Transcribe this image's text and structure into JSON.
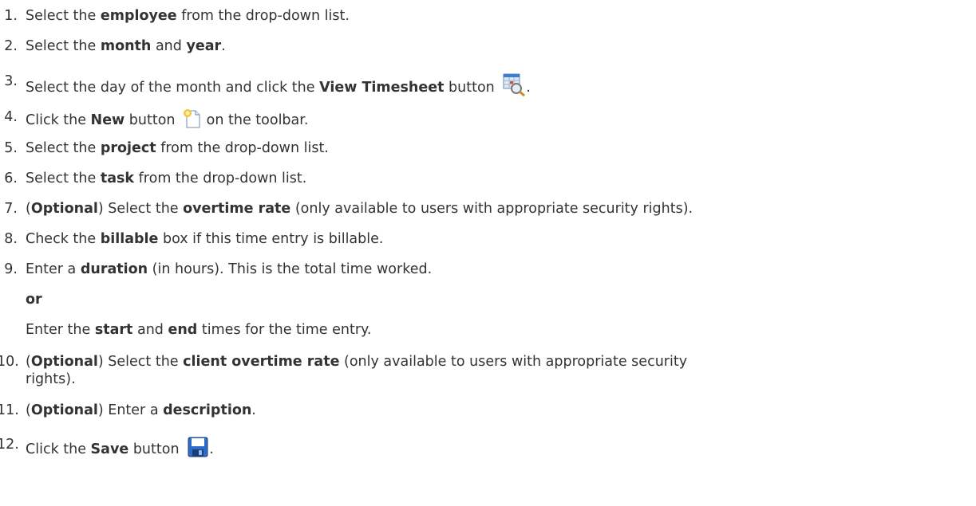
{
  "steps": [
    {
      "num": "1.",
      "parts": [
        [
          "Select the ",
          0
        ],
        [
          "employee",
          1
        ],
        [
          " from the drop-down list.",
          0
        ]
      ]
    },
    {
      "num": "2.",
      "parts": [
        [
          "Select the ",
          0
        ],
        [
          "month",
          1
        ],
        [
          " and ",
          0
        ],
        [
          "year",
          1
        ],
        [
          ".",
          0
        ]
      ]
    },
    {
      "num": "3.",
      "parts": [
        [
          "Select the day of the month and click the ",
          0
        ],
        [
          "View Timesheet",
          1
        ],
        [
          " button ",
          0
        ]
      ],
      "after": ".",
      "icon": "view-timesheet-icon"
    },
    {
      "num": "4.",
      "parts": [
        [
          "Click the ",
          0
        ],
        [
          "New",
          1
        ],
        [
          " button ",
          0
        ]
      ],
      "icon": "new-document-icon",
      "after": " on the toolbar."
    },
    {
      "num": "5.",
      "parts": [
        [
          "Select the ",
          0
        ],
        [
          "project",
          1
        ],
        [
          " from the drop-down list.",
          0
        ]
      ]
    },
    {
      "num": "6.",
      "parts": [
        [
          "Select the ",
          0
        ],
        [
          "task",
          1
        ],
        [
          " from the drop-down list.",
          0
        ]
      ]
    },
    {
      "num": "7.",
      "parts": [
        [
          "(",
          0
        ],
        [
          "Optional",
          1
        ],
        [
          ") Select the ",
          0
        ],
        [
          "overtime rate",
          1
        ],
        [
          " (only available to users with appropriate security rights).",
          0
        ]
      ]
    },
    {
      "num": "8.",
      "parts": [
        [
          "Check the ",
          0
        ],
        [
          "billable",
          1
        ],
        [
          " box if this time entry is billable.",
          0
        ]
      ]
    },
    {
      "num": "9.",
      "parts": [
        [
          "Enter a ",
          0
        ],
        [
          "duration",
          1
        ],
        [
          " (in hours). This is the total time worked.",
          0
        ]
      ]
    },
    {
      "num": "",
      "parts": [
        [
          "or",
          1
        ]
      ]
    },
    {
      "num": "",
      "parts": [
        [
          "Enter the ",
          0
        ],
        [
          "start",
          1
        ],
        [
          " and ",
          0
        ],
        [
          "end",
          1
        ],
        [
          " times for the time entry.",
          0
        ]
      ]
    },
    {
      "num": "10.",
      "parts": [
        [
          "(",
          0
        ],
        [
          "Optional",
          1
        ],
        [
          ") Select the ",
          0
        ],
        [
          "client overtime rate",
          1
        ],
        [
          " (only available to users with appropriate security",
          0
        ]
      ]
    },
    {
      "num": "",
      "parts": [
        [
          "rights).",
          0
        ]
      ]
    },
    {
      "num": "11.",
      "parts": [
        [
          "(",
          0
        ],
        [
          "Optional",
          1
        ],
        [
          ") Enter a ",
          0
        ],
        [
          "description",
          1
        ],
        [
          ".",
          0
        ]
      ]
    },
    {
      "num": "12.",
      "parts": [
        [
          "Click the ",
          0
        ],
        [
          "Save",
          1
        ],
        [
          " button ",
          0
        ]
      ],
      "icon": "save-icon",
      "after": "."
    }
  ],
  "icons": {
    "view_timesheet": {
      "name": "view-timesheet-icon",
      "colors": [
        "#3b7fd0",
        "#d94a2b",
        "#7a7a7a"
      ]
    },
    "new_document": {
      "name": "new-document-icon",
      "colors": [
        "#f5c542",
        "#ffffff",
        "#6a8fb8"
      ]
    },
    "save": {
      "name": "save-icon",
      "colors": [
        "#2f6cc8",
        "#ffffff",
        "#173f7a"
      ]
    }
  }
}
